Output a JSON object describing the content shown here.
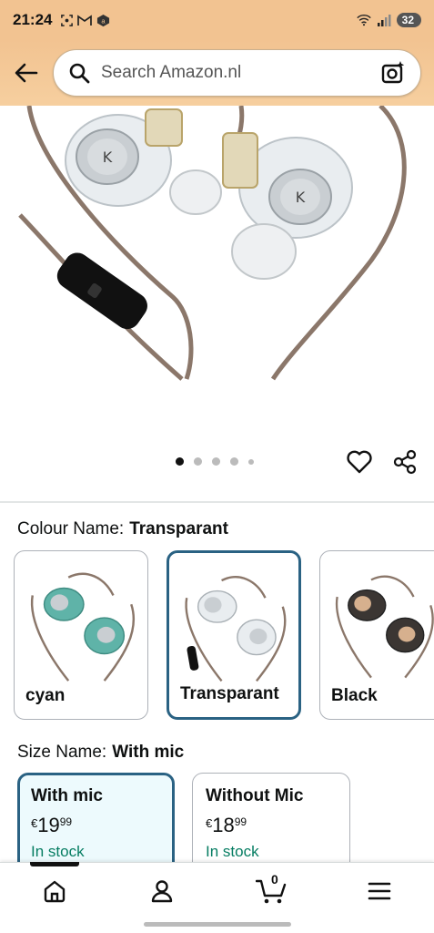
{
  "status_bar": {
    "time": "21:24",
    "battery": "32"
  },
  "search": {
    "placeholder": "Search Amazon.nl"
  },
  "carousel": {
    "total_dots": 5,
    "active_index": 0
  },
  "colour": {
    "label": "Colour Name:",
    "selected": "Transparant",
    "options": [
      {
        "label": "cyan"
      },
      {
        "label": "Transparant"
      },
      {
        "label": "Black"
      }
    ]
  },
  "size": {
    "label": "Size Name:",
    "selected": "With mic",
    "options": [
      {
        "label": "With mic",
        "currency": "€",
        "whole": "19",
        "fraction": "99",
        "stock": "In stock"
      },
      {
        "label": "Without Mic",
        "currency": "€",
        "whole": "18",
        "fraction": "99",
        "stock": "In stock"
      }
    ]
  },
  "bottom_nav": {
    "cart_count": "0"
  },
  "colors": {
    "header": "#f2c391",
    "selected_border": "#2a6283",
    "in_stock": "#067d62"
  }
}
